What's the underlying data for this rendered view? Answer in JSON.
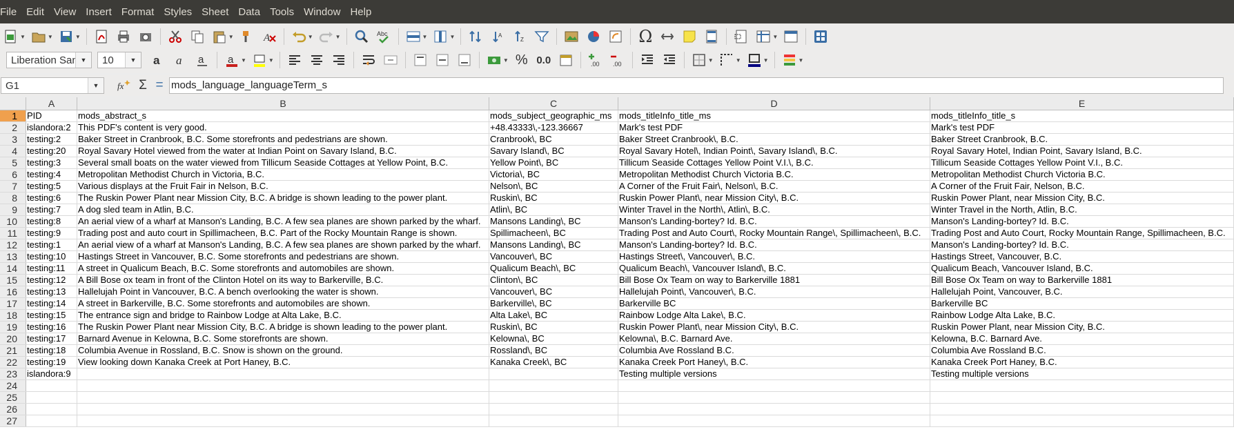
{
  "menu": [
    "File",
    "Edit",
    "View",
    "Insert",
    "Format",
    "Styles",
    "Sheet",
    "Data",
    "Tools",
    "Window",
    "Help"
  ],
  "toolbar": {
    "font_name": "Liberation Sans",
    "font_size": "10",
    "number_format_percent": "%",
    "number_format_decimal": "0.0",
    "omega": "Ω"
  },
  "formula_bar": {
    "name_box": "G1",
    "sum_symbol": "Σ",
    "equals_symbol": "=",
    "content": "mods_language_languageTerm_s"
  },
  "columns": [
    "A",
    "B",
    "C",
    "D",
    "E"
  ],
  "rows": [
    {
      "n": "1",
      "cells": [
        "PID",
        "mods_abstract_s",
        "mods_subject_geographic_ms",
        "mods_titleInfo_title_ms",
        "mods_titleInfo_title_s"
      ]
    },
    {
      "n": "2",
      "cells": [
        "islandora:2",
        "This PDF's content is very good.",
        "+48.43333\\,-123.36667",
        "Mark's test PDF",
        "Mark's test PDF"
      ]
    },
    {
      "n": "3",
      "cells": [
        "testing:2",
        "Baker Street in Cranbrook, B.C. Some storefronts and pedestrians are shown.",
        "Cranbrook\\, BC",
        "Baker Street Cranbrook\\, B.C.",
        "Baker Street Cranbrook, B.C."
      ]
    },
    {
      "n": "4",
      "cells": [
        "testing:20",
        "Royal Savary Hotel viewed from the water at Indian Point on Savary Island, B.C.",
        "Savary Island\\, BC",
        "Royal Savary Hotel\\, Indian Point\\, Savary Island\\, B.C.",
        "Royal Savary Hotel, Indian Point, Savary Island, B.C."
      ]
    },
    {
      "n": "5",
      "cells": [
        "testing:3",
        "Several small boats on the water viewed from Tillicum Seaside Cottages at Yellow Point, B.C.",
        "Yellow Point\\, BC",
        "Tillicum Seaside Cottages Yellow Point V.I.\\, B.C.",
        "Tillicum Seaside Cottages Yellow Point V.I., B.C."
      ]
    },
    {
      "n": "6",
      "cells": [
        "testing:4",
        "Metropolitan Methodist Church in Victoria, B.C.",
        "Victoria\\, BC",
        "Metropolitan Methodist Church Victoria B.C.",
        "Metropolitan Methodist Church Victoria B.C."
      ]
    },
    {
      "n": "7",
      "cells": [
        "testing:5",
        "Various displays at the Fruit Fair in Nelson, B.C.",
        "Nelson\\, BC",
        "A Corner of the Fruit Fair\\, Nelson\\, B.C.",
        "A Corner of the Fruit Fair, Nelson, B.C."
      ]
    },
    {
      "n": "8",
      "cells": [
        "testing:6",
        "The Ruskin Power Plant near Mission City, B.C. A bridge is shown leading to the power plant.",
        "Ruskin\\, BC",
        "Ruskin Power Plant\\, near Mission City\\, B.C.",
        "Ruskin Power Plant, near Mission City, B.C."
      ]
    },
    {
      "n": "9",
      "cells": [
        "testing:7",
        "A dog sled team in Atlin, B.C.",
        "Atlin\\, BC",
        "Winter Travel in the North\\, Atlin\\, B.C.",
        "Winter Travel in the North, Atlin, B.C."
      ]
    },
    {
      "n": "10",
      "cells": [
        "testing:8",
        "An aerial view of a wharf at Manson's Landing, B.C. A few sea planes are shown parked by the wharf.",
        "Mansons Landing\\, BC",
        "Manson's Landing-bortey? Id. B.C.",
        "Manson's Landing-bortey? Id. B.C."
      ]
    },
    {
      "n": "11",
      "cells": [
        "testing:9",
        "Trading post and auto court in Spillimacheen, B.C. Part of the Rocky Mountain Range is shown.",
        "Spillimacheen\\, BC",
        "Trading Post and Auto Court\\, Rocky Mountain Range\\, Spillimacheen\\, B.C.",
        "Trading Post and Auto Court, Rocky Mountain Range, Spillimacheen, B.C."
      ]
    },
    {
      "n": "12",
      "cells": [
        "testing:1",
        "An aerial view of a wharf at Manson's Landing, B.C. A few sea planes are shown parked by the wharf.",
        "Mansons Landing\\, BC",
        "Manson's Landing-bortey? Id. B.C.",
        "Manson's Landing-bortey? Id. B.C."
      ]
    },
    {
      "n": "13",
      "cells": [
        "testing:10",
        "Hastings Street in Vancouver, B.C. Some storefronts and pedestrians are shown.",
        "Vancouver\\, BC",
        "Hastings Street\\, Vancouver\\, B.C.",
        "Hastings Street, Vancouver, B.C."
      ]
    },
    {
      "n": "14",
      "cells": [
        "testing:11",
        "A street in Qualicum Beach, B.C. Some storefronts and automobiles are shown.",
        "Qualicum Beach\\, BC",
        "Qualicum Beach\\, Vancouver Island\\, B.C.",
        "Qualicum Beach, Vancouver Island, B.C."
      ]
    },
    {
      "n": "15",
      "cells": [
        "testing:12",
        "A Bill Bose ox team in front of the Clinton Hotel on its way to Barkerville, B.C.",
        "Clinton\\, BC",
        "Bill Bose Ox Team on way to Barkerville 1881",
        "Bill Bose Ox Team on way to Barkerville 1881"
      ]
    },
    {
      "n": "16",
      "cells": [
        "testing:13",
        "Hallelujah Point in Vancouver, B.C. A bench overlooking the water is shown.",
        "Vancouver\\, BC",
        "Hallelujah Point\\, Vancouver\\, B.C.",
        "Hallelujah Point, Vancouver, B.C."
      ]
    },
    {
      "n": "17",
      "cells": [
        "testing:14",
        "A street in Barkerville, B.C. Some storefronts and automobiles are shown.",
        "Barkerville\\, BC",
        "Barkerville BC",
        "Barkerville BC"
      ]
    },
    {
      "n": "18",
      "cells": [
        "testing:15",
        "The entrance sign and bridge to Rainbow Lodge at Alta Lake, B.C.",
        "Alta Lake\\, BC",
        "Rainbow Lodge Alta Lake\\, B.C.",
        "Rainbow Lodge Alta Lake, B.C."
      ]
    },
    {
      "n": "19",
      "cells": [
        "testing:16",
        "The Ruskin Power Plant near Mission City, B.C. A bridge is shown leading to the power plant.",
        "Ruskin\\, BC",
        "Ruskin Power Plant\\, near Mission City\\, B.C.",
        "Ruskin Power Plant, near Mission City, B.C."
      ]
    },
    {
      "n": "20",
      "cells": [
        "testing:17",
        "Barnard Avenue in Kelowna, B.C. Some storefronts are shown.",
        "Kelowna\\, BC",
        "Kelowna\\, B.C. Barnard Ave.",
        "Kelowna, B.C. Barnard Ave."
      ]
    },
    {
      "n": "21",
      "cells": [
        "testing:18",
        "Columbia Avenue in Rossland, B.C. Snow is shown on the ground.",
        "Rossland\\, BC",
        "Columbia Ave Rossland B.C.",
        "Columbia Ave Rossland B.C."
      ]
    },
    {
      "n": "22",
      "cells": [
        "testing:19",
        "View looking down Kanaka Creek at Port Haney, B.C.",
        "Kanaka Creek\\, BC",
        "Kanaka Creek Port Haney\\, B.C.",
        "Kanaka Creek Port Haney, B.C."
      ]
    },
    {
      "n": "23",
      "cells": [
        "islandora:9",
        "",
        "",
        "Testing multiple versions",
        "Testing multiple versions"
      ]
    },
    {
      "n": "24",
      "cells": [
        "",
        "",
        "",
        "",
        ""
      ]
    },
    {
      "n": "25",
      "cells": [
        "",
        "",
        "",
        "",
        ""
      ]
    },
    {
      "n": "26",
      "cells": [
        "",
        "",
        "",
        "",
        ""
      ]
    },
    {
      "n": "27",
      "cells": [
        "",
        "",
        "",
        "",
        ""
      ]
    }
  ]
}
